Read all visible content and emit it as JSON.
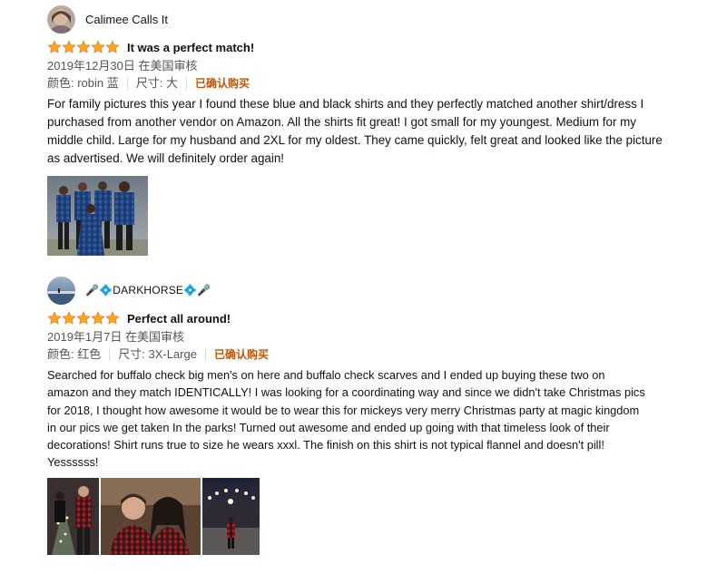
{
  "reviews": [
    {
      "author": "Calimee Calls It",
      "rating": 5,
      "title": "It was a perfect match!",
      "date": "2019年12月30日 在美国审核",
      "variant_color": "颜色: robin 蓝",
      "variant_size": "尺寸: 大",
      "verified": "已确认购买",
      "body": "For family pictures this year I found these blue and black shirts and they perfectly matched another shirt/dress I purchased from another vendor on Amazon. All the shirts fit great! I got small for my youngest. Medium for my middle child. Large for my husband and 2XL for my oldest. They came quickly, felt great and looked like the picture as advertised. We will definitely order again!"
    },
    {
      "author": "🎤💠DARKHORSE💠🎤",
      "rating": 5,
      "title": "Perfect all around!",
      "date": "2019年1月7日 在美国审核",
      "variant_color": "颜色: 红色",
      "variant_size": "尺寸: 3X-Large",
      "verified": "已确认购买",
      "body": "Searched for buffalo check big men's on here and buffalo check scarves and I ended up buying these two on amazon and they match IDENTICALLY! I was looking for a coordinating way and since we didn't take Christmas pics for 2018, I thought how awesome it would be to wear this for mickeys very merry Christmas party at magic kingdom in our pics we get taken In the parks! Turned out awesome and ended up going with that timeless look of their decorations! Shirt runs true to size he wears xxxl. The finish on this shirt is not typical flannel and doesn't pill! Yessssss!"
    }
  ],
  "colors": {
    "star": "#FFA41C",
    "star_outline": "#DE7921",
    "verified": "#C45500",
    "meta": "#555555"
  }
}
